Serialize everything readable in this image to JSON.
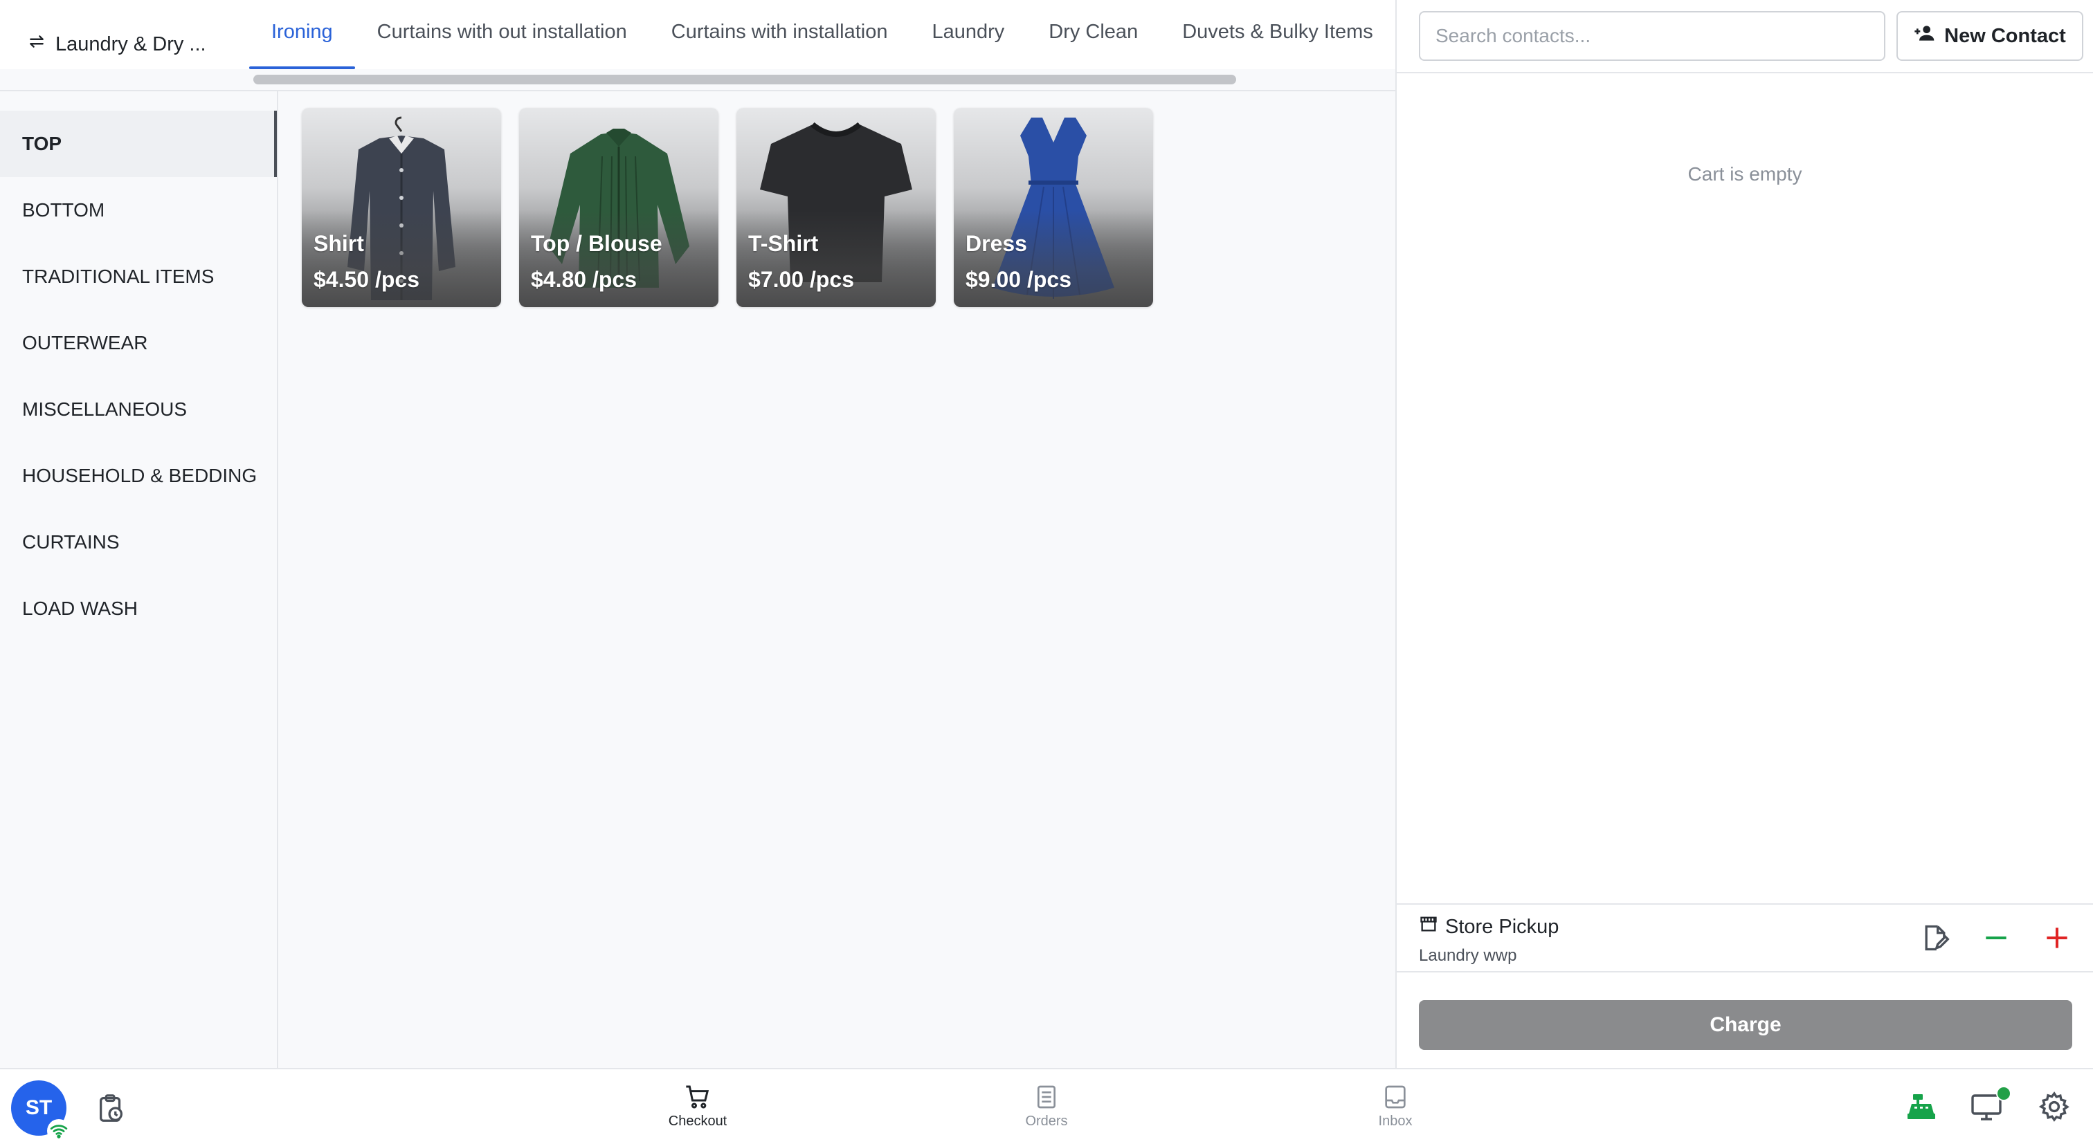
{
  "store": {
    "name": "Laundry & Dry ..."
  },
  "tabs": [
    {
      "label": "Ironing",
      "active": true
    },
    {
      "label": "Curtains with out installation",
      "active": false
    },
    {
      "label": "Curtains with installation",
      "active": false
    },
    {
      "label": "Laundry",
      "active": false
    },
    {
      "label": "Dry Clean",
      "active": false
    },
    {
      "label": "Duvets & Bulky Items",
      "active": false
    }
  ],
  "categories": [
    {
      "label": "TOP",
      "active": true
    },
    {
      "label": "BOTTOM"
    },
    {
      "label": "TRADITIONAL ITEMS"
    },
    {
      "label": "OUTERWEAR"
    },
    {
      "label": "MISCELLANEOUS"
    },
    {
      "label": "HOUSEHOLD & BEDDING"
    },
    {
      "label": "CURTAINS"
    },
    {
      "label": "LOAD WASH"
    }
  ],
  "products": [
    {
      "name": "Shirt",
      "price": "$4.50 /pcs",
      "icon": "shirt-image",
      "color": "#3d4350"
    },
    {
      "name": "Top / Blouse",
      "price": "$4.80 /pcs",
      "icon": "blouse-image",
      "color": "#2e5a3c"
    },
    {
      "name": "T-Shirt",
      "price": "$7.00 /pcs",
      "icon": "tshirt-image",
      "color": "#2b2c2f"
    },
    {
      "name": "Dress",
      "price": "$9.00 /pcs",
      "icon": "dress-image",
      "color": "#2a4fa6"
    }
  ],
  "contacts": {
    "search_placeholder": "Search contacts...",
    "new_contact_label": "New Contact"
  },
  "cart": {
    "empty_text": "Cart is empty"
  },
  "pickup": {
    "title": "Store Pickup",
    "subtitle": "Laundry wwp"
  },
  "charge": {
    "label": "Charge"
  },
  "user": {
    "initials": "ST"
  },
  "nav": {
    "checkout": "Checkout",
    "orders": "Orders",
    "inbox": "Inbox"
  },
  "colors": {
    "accent": "#2a62d8",
    "avatar": "#2563eb",
    "plus": "#e02424",
    "minus": "#16a34a",
    "register": "#16a34a",
    "charge_disabled": "#8a8b8d"
  }
}
